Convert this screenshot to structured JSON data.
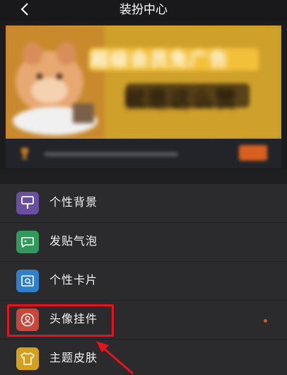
{
  "header": {
    "title": "装扮中心",
    "back_icon": "chevron-left-icon"
  },
  "banner": {
    "headline_line1": "超级会员免广告",
    "headline_line2": "就是这么赞",
    "notice_icon": "trophy-icon"
  },
  "menu": {
    "items": [
      {
        "label": "个性背景",
        "icon": "brush-icon",
        "color": "#6a4fa0"
      },
      {
        "label": "发贴气泡",
        "icon": "chat-bubble-icon",
        "color": "#2f9a5c"
      },
      {
        "label": "个性卡片",
        "icon": "card-icon",
        "color": "#2f7fc9"
      },
      {
        "label": "头像挂件",
        "icon": "avatar-icon",
        "color": "#c8463a",
        "has_dot": true
      },
      {
        "label": "主题皮肤",
        "icon": "tshirt-icon",
        "color": "#d5a11c"
      }
    ]
  },
  "colors": {
    "highlight": "#e8121c",
    "dot": "#d9562a",
    "background": "#2b2b2d"
  }
}
